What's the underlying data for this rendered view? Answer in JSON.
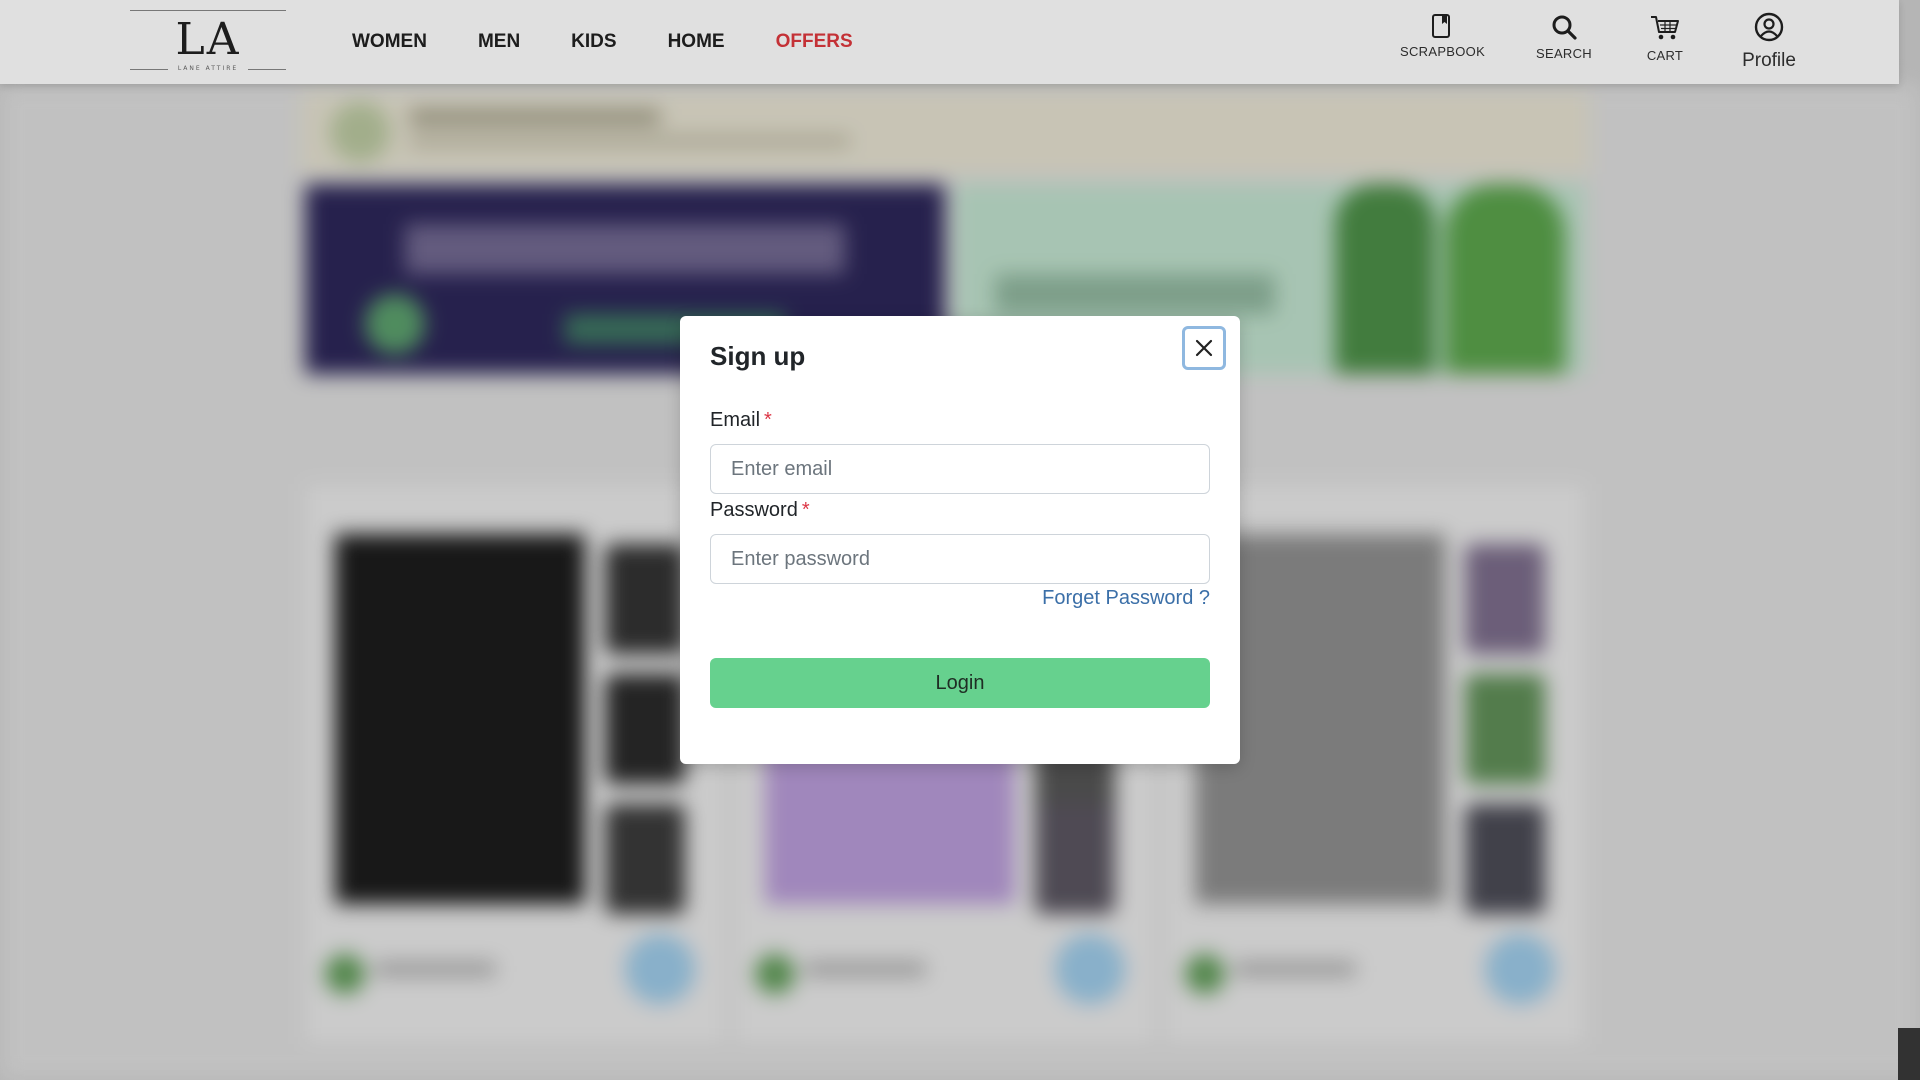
{
  "brand": {
    "logo_mark": "LA",
    "logo_sub": "LANE ATTIRE"
  },
  "nav": {
    "items": [
      {
        "label": "WOMEN"
      },
      {
        "label": "MEN"
      },
      {
        "label": "KIDS"
      },
      {
        "label": "HOME"
      },
      {
        "label": "OFFERS",
        "accent": "#e0383e"
      }
    ]
  },
  "tools": {
    "scrapbook": {
      "label": "SCRAPBOOK",
      "icon": "bookmark-icon"
    },
    "search": {
      "label": "SEARCH",
      "icon": "search-icon"
    },
    "cart": {
      "label": "CART",
      "icon": "cart-icon"
    },
    "profile": {
      "label": "Profile",
      "icon": "user-circle-icon"
    }
  },
  "modal": {
    "title": "Sign up",
    "close_icon": "close-icon",
    "email": {
      "label": "Email",
      "required_mark": "*",
      "placeholder": "Enter email",
      "value": ""
    },
    "password": {
      "label": "Password",
      "required_mark": "*",
      "placeholder": "Enter password",
      "value": ""
    },
    "forgot_label": "Forget Password ?",
    "login_label": "Login",
    "login_color": "#66d18e"
  }
}
